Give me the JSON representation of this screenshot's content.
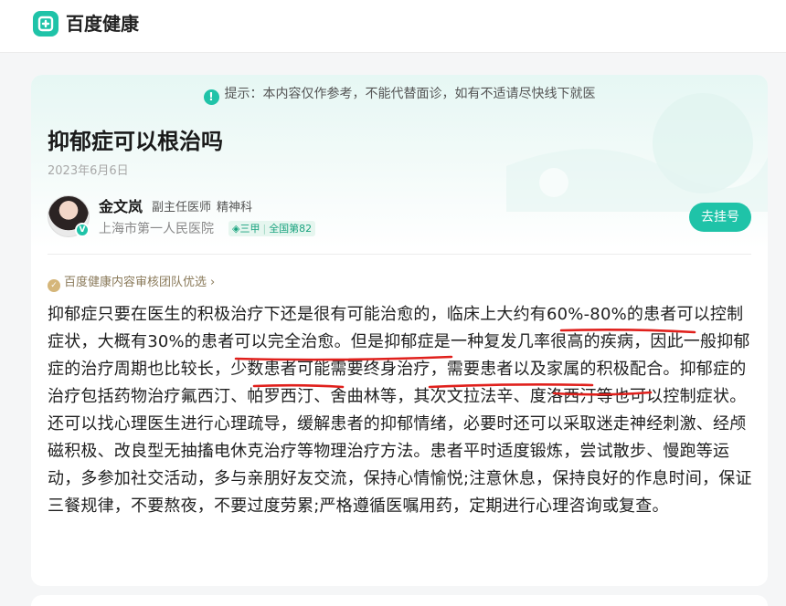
{
  "header": {
    "logo_text": "百度健康",
    "logo_icon": "baidu-health-logo-icon"
  },
  "notice": {
    "text": "提示：本内容仅作参考，不能代替面诊，如有不适请尽快线下就医"
  },
  "article": {
    "title": "抑郁症可以根治吗",
    "date": "2023年6月6日",
    "body": "抑郁症只要在医生的积极治疗下还是很有可能治愈的，临床上大约有60%-80%的患者可以控制症状，大概有30%的患者可以完全治愈。但是抑郁症是一种复发几率很高的疾病，因此一般抑郁症的治疗周期也比较长，少数患者可能需要终身治疗，需要患者以及家属的积极配合。抑郁症的治疗包括药物治疗氟西汀、帕罗西汀、舍曲林等，其次文拉法辛、度洛西汀等也可以控制症状。还可以找心理医生进行心理疏导，缓解患者的抑郁情绪，必要时还可以采取迷走神经刺激、经颅磁积极、改良型无抽搐电休克治疗等物理治疗方法。患者平时适度锻炼，尝试散步、慢跑等运动，多参加社交活动，多与亲朋好友交流，保持心情愉悦;注意休息，保持良好的作息时间，保证三餐规律，不要熬夜，不要过度劳累;严格遵循医嘱用药，定期进行心理咨询或复查。"
  },
  "doctor": {
    "name": "金文岚",
    "rank": "副主任医师",
    "department": "精神科",
    "hospital": "上海市第一人民医院",
    "badge_level": "三甲",
    "badge_rank": "全国第82",
    "book_label": "去挂号"
  },
  "review": {
    "label": "百度健康内容审核团队优选"
  },
  "colors": {
    "accent": "#1fc3a8",
    "annotation": "#e0201c",
    "review": "#8a7a5a"
  }
}
